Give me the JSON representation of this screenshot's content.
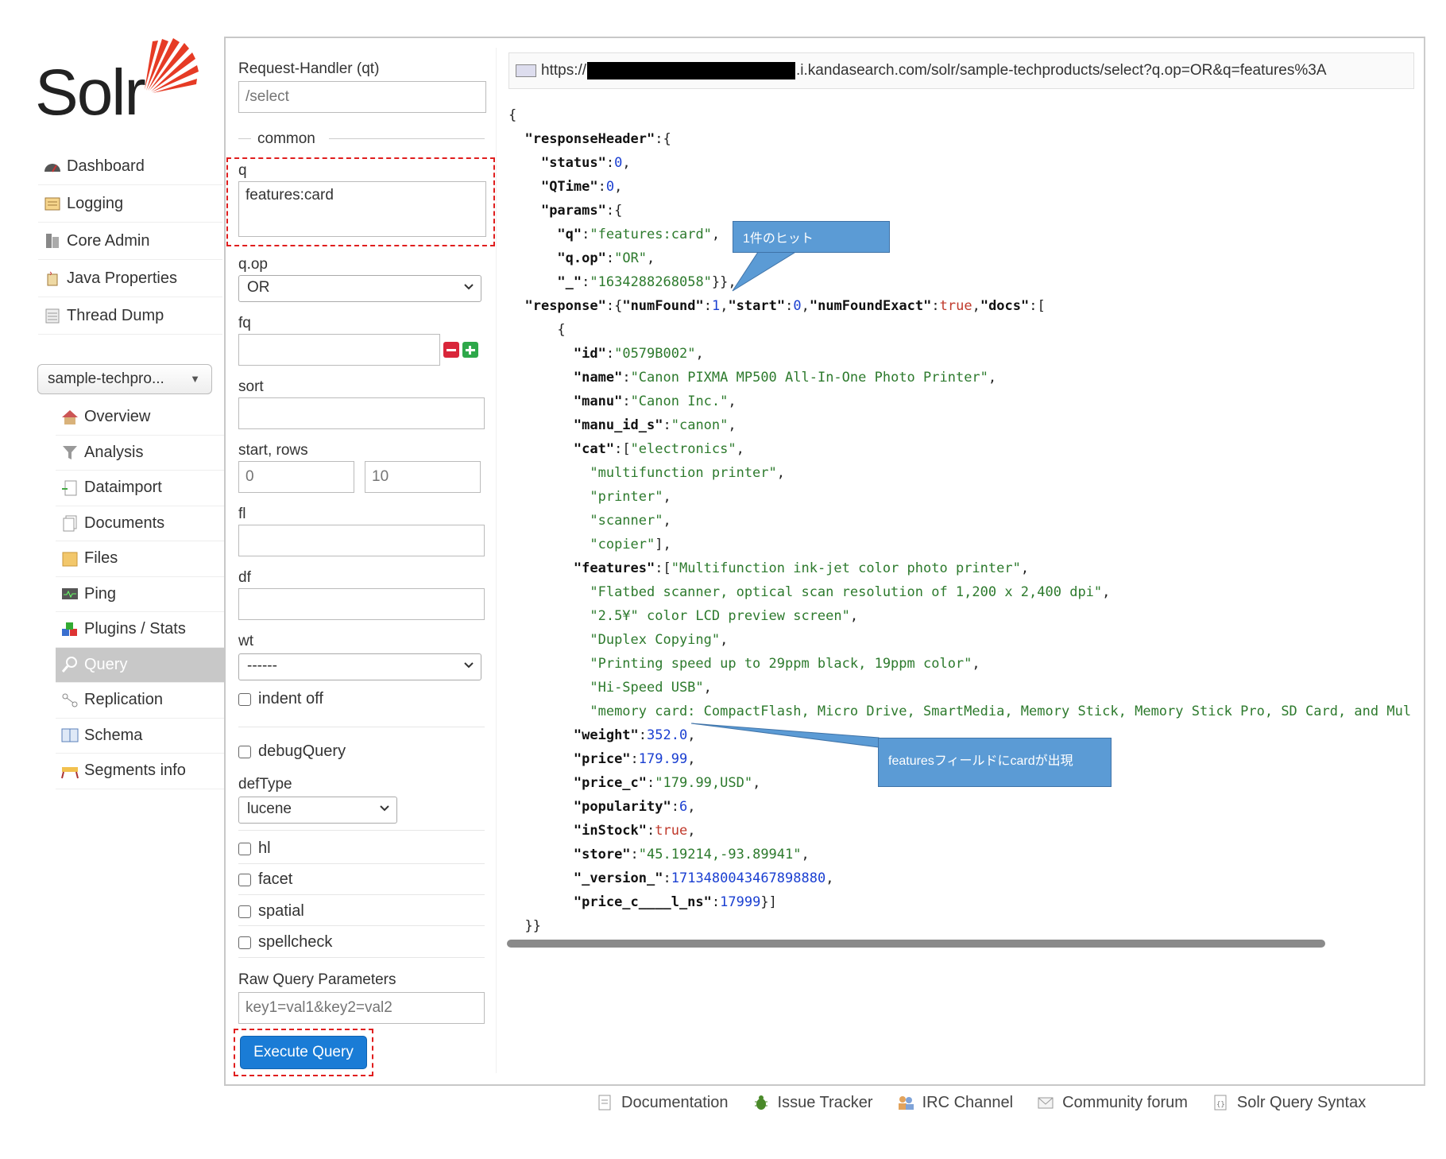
{
  "app": {
    "logo_text": "Solr"
  },
  "main_nav": [
    {
      "label": "Dashboard",
      "icon": "dashboard-icon"
    },
    {
      "label": "Logging",
      "icon": "logging-icon"
    },
    {
      "label": "Core Admin",
      "icon": "core-admin-icon"
    },
    {
      "label": "Java Properties",
      "icon": "java-icon"
    },
    {
      "label": "Thread Dump",
      "icon": "thread-dump-icon"
    }
  ],
  "core_selector": {
    "value": "sample-techpro..."
  },
  "core_nav": [
    {
      "label": "Overview",
      "icon": "home-icon"
    },
    {
      "label": "Analysis",
      "icon": "filter-icon"
    },
    {
      "label": "Dataimport",
      "icon": "dataimport-icon"
    },
    {
      "label": "Documents",
      "icon": "documents-icon"
    },
    {
      "label": "Files",
      "icon": "folder-icon"
    },
    {
      "label": "Ping",
      "icon": "ping-icon"
    },
    {
      "label": "Plugins / Stats",
      "icon": "plugins-icon"
    },
    {
      "label": "Query",
      "icon": "magnifier-icon",
      "active": true
    },
    {
      "label": "Replication",
      "icon": "replication-icon"
    },
    {
      "label": "Schema",
      "icon": "schema-icon"
    },
    {
      "label": "Segments info",
      "icon": "segments-icon"
    }
  ],
  "form": {
    "qt_label": "Request-Handler (qt)",
    "qt_placeholder": "/select",
    "common_label": "common",
    "q_label": "q",
    "q_value": "features:card",
    "qop_label": "q.op",
    "qop_value": "OR",
    "fq_label": "fq",
    "sort_label": "sort",
    "start_rows_label": "start, rows",
    "start_value": "0",
    "rows_value": "10",
    "fl_label": "fl",
    "df_label": "df",
    "wt_label": "wt",
    "wt_value": "------",
    "indent_label": "indent off",
    "debug_label": "debugQuery",
    "deftype_label": "defType",
    "deftype_value": "lucene",
    "hl_label": "hl",
    "facet_label": "facet",
    "spatial_label": "spatial",
    "spellcheck_label": "spellcheck",
    "raw_label": "Raw Query Parameters",
    "raw_placeholder": "key1=val1&key2=val2",
    "execute_label": "Execute Query"
  },
  "response": {
    "url_prefix": "https://",
    "url_suffix": ".i.kandasearch.com/solr/sample-techproducts/select?q.op=OR&q=features%3A"
  },
  "callouts": {
    "hit": "1件のヒット",
    "features": "featuresフィールドにcardが出現"
  },
  "footer": [
    {
      "label": "Documentation",
      "icon": "doc-icon"
    },
    {
      "label": "Issue Tracker",
      "icon": "bug-icon"
    },
    {
      "label": "IRC Channel",
      "icon": "irc-icon"
    },
    {
      "label": "Community forum",
      "icon": "mail-icon"
    },
    {
      "label": "Solr Query Syntax",
      "icon": "syntax-icon"
    }
  ],
  "json_lines": [
    [
      [
        "p",
        "{"
      ]
    ],
    [
      [
        "p",
        "  "
      ],
      [
        "k",
        "\"responseHeader\""
      ],
      [
        "p",
        ":{"
      ]
    ],
    [
      [
        "p",
        "    "
      ],
      [
        "k",
        "\"status\""
      ],
      [
        "p",
        ":"
      ],
      [
        "n",
        "0"
      ],
      [
        "p",
        ","
      ]
    ],
    [
      [
        "p",
        "    "
      ],
      [
        "k",
        "\"QTime\""
      ],
      [
        "p",
        ":"
      ],
      [
        "n",
        "0"
      ],
      [
        "p",
        ","
      ]
    ],
    [
      [
        "p",
        "    "
      ],
      [
        "k",
        "\"params\""
      ],
      [
        "p",
        ":{"
      ]
    ],
    [
      [
        "p",
        "      "
      ],
      [
        "k",
        "\"q\""
      ],
      [
        "p",
        ":"
      ],
      [
        "s",
        "\"features:card\""
      ],
      [
        "p",
        ","
      ]
    ],
    [
      [
        "p",
        "      "
      ],
      [
        "k",
        "\"q.op\""
      ],
      [
        "p",
        ":"
      ],
      [
        "s",
        "\"OR\""
      ],
      [
        "p",
        ","
      ]
    ],
    [
      [
        "p",
        "      "
      ],
      [
        "k",
        "\"_\""
      ],
      [
        "p",
        ":"
      ],
      [
        "s",
        "\"1634288268058\""
      ],
      [
        "p",
        "}},"
      ]
    ],
    [
      [
        "p",
        "  "
      ],
      [
        "k",
        "\"response\""
      ],
      [
        "p",
        ":{"
      ],
      [
        "k",
        "\"numFound\""
      ],
      [
        "p",
        ":"
      ],
      [
        "n",
        "1"
      ],
      [
        "p",
        ","
      ],
      [
        "k",
        "\"start\""
      ],
      [
        "p",
        ":"
      ],
      [
        "n",
        "0"
      ],
      [
        "p",
        ","
      ],
      [
        "k",
        "\"numFoundExact\""
      ],
      [
        "p",
        ":"
      ],
      [
        "b",
        "true"
      ],
      [
        "p",
        ","
      ],
      [
        "k",
        "\"docs\""
      ],
      [
        "p",
        ":["
      ]
    ],
    [
      [
        "p",
        "      {"
      ]
    ],
    [
      [
        "p",
        "        "
      ],
      [
        "k",
        "\"id\""
      ],
      [
        "p",
        ":"
      ],
      [
        "s",
        "\"0579B002\""
      ],
      [
        "p",
        ","
      ]
    ],
    [
      [
        "p",
        "        "
      ],
      [
        "k",
        "\"name\""
      ],
      [
        "p",
        ":"
      ],
      [
        "s",
        "\"Canon PIXMA MP500 All-In-One Photo Printer\""
      ],
      [
        "p",
        ","
      ]
    ],
    [
      [
        "p",
        "        "
      ],
      [
        "k",
        "\"manu\""
      ],
      [
        "p",
        ":"
      ],
      [
        "s",
        "\"Canon Inc.\""
      ],
      [
        "p",
        ","
      ]
    ],
    [
      [
        "p",
        "        "
      ],
      [
        "k",
        "\"manu_id_s\""
      ],
      [
        "p",
        ":"
      ],
      [
        "s",
        "\"canon\""
      ],
      [
        "p",
        ","
      ]
    ],
    [
      [
        "p",
        "        "
      ],
      [
        "k",
        "\"cat\""
      ],
      [
        "p",
        ":["
      ],
      [
        "s",
        "\"electronics\""
      ],
      [
        "p",
        ","
      ]
    ],
    [
      [
        "p",
        "          "
      ],
      [
        "s",
        "\"multifunction printer\""
      ],
      [
        "p",
        ","
      ]
    ],
    [
      [
        "p",
        "          "
      ],
      [
        "s",
        "\"printer\""
      ],
      [
        "p",
        ","
      ]
    ],
    [
      [
        "p",
        "          "
      ],
      [
        "s",
        "\"scanner\""
      ],
      [
        "p",
        ","
      ]
    ],
    [
      [
        "p",
        "          "
      ],
      [
        "s",
        "\"copier\""
      ],
      [
        "p",
        "],"
      ]
    ],
    [
      [
        "p",
        "        "
      ],
      [
        "k",
        "\"features\""
      ],
      [
        "p",
        ":["
      ],
      [
        "s",
        "\"Multifunction ink-jet color photo printer\""
      ],
      [
        "p",
        ","
      ]
    ],
    [
      [
        "p",
        "          "
      ],
      [
        "s",
        "\"Flatbed scanner, optical scan resolution of 1,200 x 2,400 dpi\""
      ],
      [
        "p",
        ","
      ]
    ],
    [
      [
        "p",
        "          "
      ],
      [
        "s",
        "\"2.5¥\" color LCD preview screen\""
      ],
      [
        "p",
        ","
      ]
    ],
    [
      [
        "p",
        "          "
      ],
      [
        "s",
        "\"Duplex Copying\""
      ],
      [
        "p",
        ","
      ]
    ],
    [
      [
        "p",
        "          "
      ],
      [
        "s",
        "\"Printing speed up to 29ppm black, 19ppm color\""
      ],
      [
        "p",
        ","
      ]
    ],
    [
      [
        "p",
        "          "
      ],
      [
        "s",
        "\"Hi-Speed USB\""
      ],
      [
        "p",
        ","
      ]
    ],
    [
      [
        "p",
        "          "
      ],
      [
        "s",
        "\"memory card: CompactFlash, Micro Drive, SmartMedia, Memory Stick, Memory Stick Pro, SD Card, and Multi"
      ]
    ],
    [
      [
        "p",
        "        "
      ],
      [
        "k",
        "\"weight\""
      ],
      [
        "p",
        ":"
      ],
      [
        "n",
        "352.0"
      ],
      [
        "p",
        ","
      ]
    ],
    [
      [
        "p",
        "        "
      ],
      [
        "k",
        "\"price\""
      ],
      [
        "p",
        ":"
      ],
      [
        "n",
        "179.99"
      ],
      [
        "p",
        ","
      ]
    ],
    [
      [
        "p",
        "        "
      ],
      [
        "k",
        "\"price_c\""
      ],
      [
        "p",
        ":"
      ],
      [
        "s",
        "\"179.99,USD\""
      ],
      [
        "p",
        ","
      ]
    ],
    [
      [
        "p",
        "        "
      ],
      [
        "k",
        "\"popularity\""
      ],
      [
        "p",
        ":"
      ],
      [
        "n",
        "6"
      ],
      [
        "p",
        ","
      ]
    ],
    [
      [
        "p",
        "        "
      ],
      [
        "k",
        "\"inStock\""
      ],
      [
        "p",
        ":"
      ],
      [
        "b",
        "true"
      ],
      [
        "p",
        ","
      ]
    ],
    [
      [
        "p",
        "        "
      ],
      [
        "k",
        "\"store\""
      ],
      [
        "p",
        ":"
      ],
      [
        "s",
        "\"45.19214,-93.89941\""
      ],
      [
        "p",
        ","
      ]
    ],
    [
      [
        "p",
        "        "
      ],
      [
        "k",
        "\"_version_\""
      ],
      [
        "p",
        ":"
      ],
      [
        "n",
        "1713480043467898880"
      ],
      [
        "p",
        ","
      ]
    ],
    [
      [
        "p",
        "        "
      ],
      [
        "k",
        "\"price_c____l_ns\""
      ],
      [
        "p",
        ":"
      ],
      [
        "n",
        "17999"
      ],
      [
        "p",
        "}]"
      ]
    ],
    [
      [
        "p",
        "  }}"
      ]
    ]
  ]
}
